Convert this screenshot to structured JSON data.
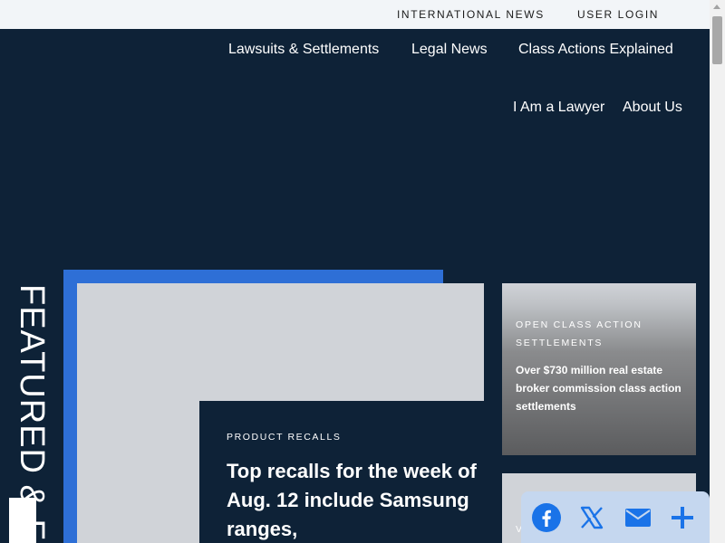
{
  "topbar": {
    "international_news": "INTERNATIONAL NEWS",
    "user_login": "USER LOGIN"
  },
  "nav": {
    "items": [
      {
        "label": "Lawsuits & Settlements"
      },
      {
        "label": "Legal News"
      },
      {
        "label": "Class Actions Explained"
      },
      {
        "label": "I Am a Lawyer"
      },
      {
        "label": "About Us"
      }
    ]
  },
  "featured": {
    "vertical_label": "FEATURED & F",
    "main": {
      "kicker": "PRODUCT RECALLS",
      "headline": "Top recalls for the week of Aug. 12 include Samsung ranges,"
    },
    "side": {
      "kicker": "OPEN CLASS ACTION SETTLEMENTS",
      "title": "Over $730 million real estate broker commission class action settlements"
    },
    "side2": {
      "kicker": "V"
    }
  },
  "share": {
    "icons": [
      "facebook-icon",
      "x-icon",
      "email-icon",
      "plus-icon"
    ]
  },
  "colors": {
    "navy": "#0e2237",
    "accent_blue": "#2e6fd6",
    "share_icon": "#1a73e8"
  }
}
